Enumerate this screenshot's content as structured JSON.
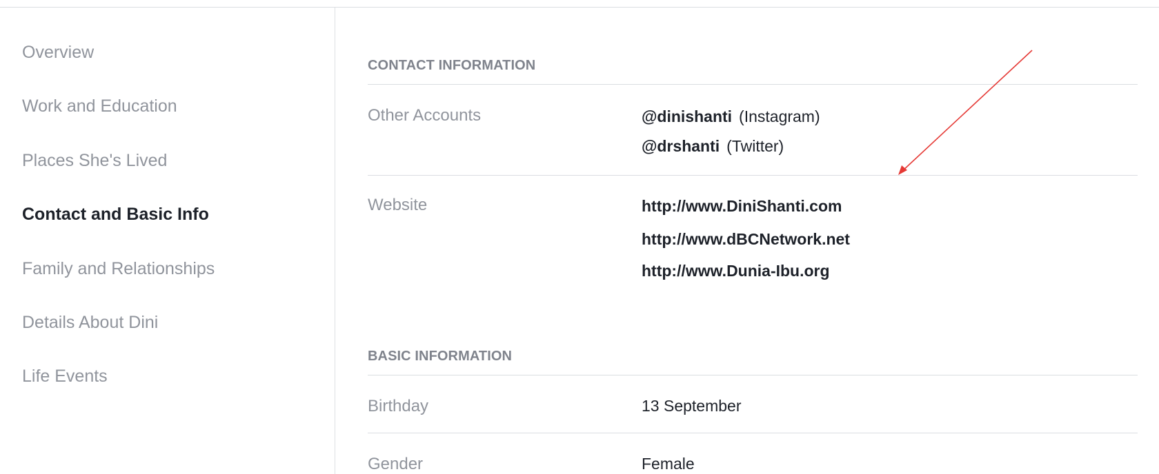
{
  "sidebar": {
    "items": [
      {
        "label": "Overview"
      },
      {
        "label": "Work and Education"
      },
      {
        "label": "Places She's Lived"
      },
      {
        "label": "Contact and Basic Info",
        "active": true
      },
      {
        "label": "Family and Relationships"
      },
      {
        "label": "Details About Dini"
      },
      {
        "label": "Life Events"
      }
    ]
  },
  "contact": {
    "title": "CONTACT INFORMATION",
    "other_accounts": {
      "label": "Other Accounts",
      "accounts": [
        {
          "handle": "@dinishanti",
          "type": "(Instagram)"
        },
        {
          "handle": "@drshanti",
          "type": "(Twitter)"
        }
      ]
    },
    "website": {
      "label": "Website",
      "links": [
        "http://www.DiniShanti.com",
        "http://www.dBCNetwork.net",
        "http://www.Dunia-Ibu.org"
      ]
    }
  },
  "basic": {
    "title": "BASIC INFORMATION",
    "birthday": {
      "label": "Birthday",
      "value": "13 September"
    },
    "gender": {
      "label": "Gender",
      "value": "Female"
    }
  },
  "annotation": {
    "color": "#e53935"
  }
}
